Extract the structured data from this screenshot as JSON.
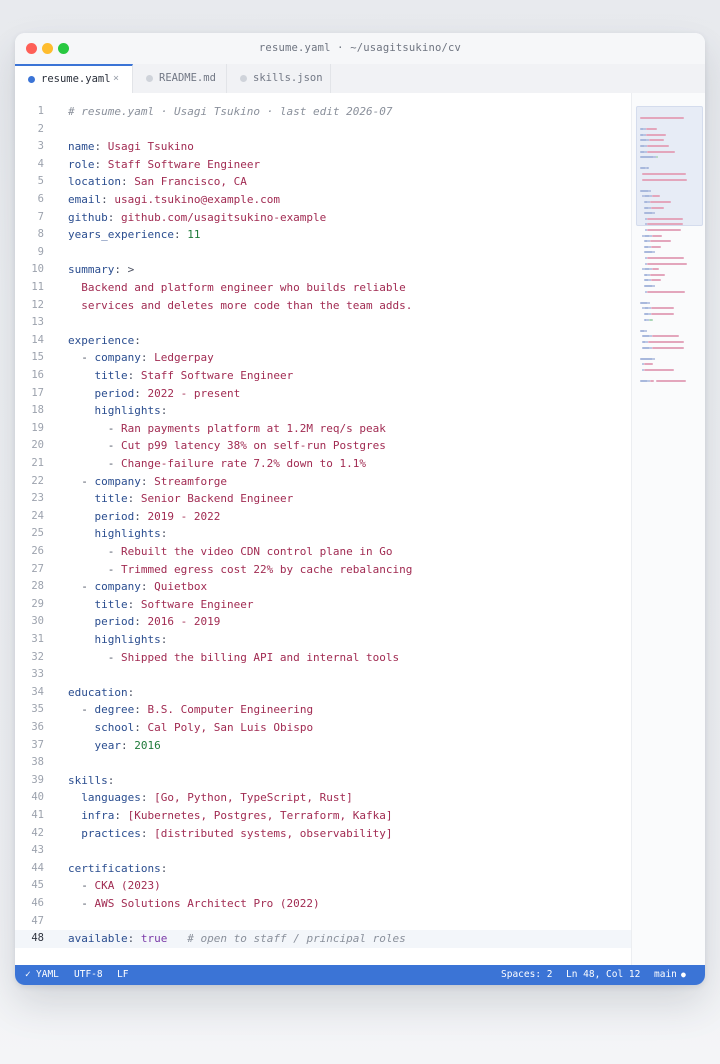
{
  "window": {
    "title": "resume.yaml · ~/usagitsukino/cv"
  },
  "tabs": [
    {
      "label": "resume.yaml",
      "close": "×",
      "active": true
    },
    {
      "label": "README.md",
      "active": false
    },
    {
      "label": "skills.json",
      "active": false
    }
  ],
  "editor": {
    "current_line": 48,
    "lines": [
      [
        [
          "c",
          "# resume.yaml · Usagi Tsukino · last edit 2026-07"
        ]
      ],
      [],
      [
        [
          "k",
          "name"
        ],
        [
          "p",
          ": "
        ],
        [
          "v",
          "Usagi Tsukino"
        ]
      ],
      [
        [
          "k",
          "role"
        ],
        [
          "p",
          ": "
        ],
        [
          "v",
          "Staff Software Engineer"
        ]
      ],
      [
        [
          "k",
          "location"
        ],
        [
          "p",
          ": "
        ],
        [
          "v",
          "San Francisco, CA"
        ]
      ],
      [
        [
          "k",
          "email"
        ],
        [
          "p",
          ": "
        ],
        [
          "v",
          "usagi.tsukino@example.com"
        ]
      ],
      [
        [
          "k",
          "github"
        ],
        [
          "p",
          ": "
        ],
        [
          "v",
          "github.com/usagitsukino-example"
        ]
      ],
      [
        [
          "k",
          "years_experience"
        ],
        [
          "p",
          ": "
        ],
        [
          "n",
          "11"
        ]
      ],
      [],
      [
        [
          "k",
          "summary"
        ],
        [
          "p",
          ": >"
        ]
      ],
      [
        [
          "v",
          "  Backend and platform engineer who builds reliable"
        ]
      ],
      [
        [
          "v",
          "  services and deletes more code than the team adds."
        ]
      ],
      [],
      [
        [
          "k",
          "experience"
        ],
        [
          "p",
          ":"
        ]
      ],
      [
        [
          "p",
          "  - "
        ],
        [
          "k",
          "company"
        ],
        [
          "p",
          ": "
        ],
        [
          "v",
          "Ledgerpay"
        ]
      ],
      [
        [
          "p",
          "    "
        ],
        [
          "k",
          "title"
        ],
        [
          "p",
          ": "
        ],
        [
          "v",
          "Staff Software Engineer"
        ]
      ],
      [
        [
          "p",
          "    "
        ],
        [
          "k",
          "period"
        ],
        [
          "p",
          ": "
        ],
        [
          "v",
          "2022 - present"
        ]
      ],
      [
        [
          "p",
          "    "
        ],
        [
          "k",
          "highlights"
        ],
        [
          "p",
          ":"
        ]
      ],
      [
        [
          "p",
          "      - "
        ],
        [
          "v",
          "Ran payments platform at 1.2M req/s peak"
        ]
      ],
      [
        [
          "p",
          "      - "
        ],
        [
          "v",
          "Cut p99 latency 38% on self-run Postgres"
        ]
      ],
      [
        [
          "p",
          "      - "
        ],
        [
          "v",
          "Change-failure rate 7.2% down to 1.1%"
        ]
      ],
      [
        [
          "p",
          "  - "
        ],
        [
          "k",
          "company"
        ],
        [
          "p",
          ": "
        ],
        [
          "v",
          "Streamforge"
        ]
      ],
      [
        [
          "p",
          "    "
        ],
        [
          "k",
          "title"
        ],
        [
          "p",
          ": "
        ],
        [
          "v",
          "Senior Backend Engineer"
        ]
      ],
      [
        [
          "p",
          "    "
        ],
        [
          "k",
          "period"
        ],
        [
          "p",
          ": "
        ],
        [
          "v",
          "2019 - 2022"
        ]
      ],
      [
        [
          "p",
          "    "
        ],
        [
          "k",
          "highlights"
        ],
        [
          "p",
          ":"
        ]
      ],
      [
        [
          "p",
          "      - "
        ],
        [
          "v",
          "Rebuilt the video CDN control plane in Go"
        ]
      ],
      [
        [
          "p",
          "      - "
        ],
        [
          "v",
          "Trimmed egress cost 22% by cache rebalancing"
        ]
      ],
      [
        [
          "p",
          "  - "
        ],
        [
          "k",
          "company"
        ],
        [
          "p",
          ": "
        ],
        [
          "v",
          "Quietbox"
        ]
      ],
      [
        [
          "p",
          "    "
        ],
        [
          "k",
          "title"
        ],
        [
          "p",
          ": "
        ],
        [
          "v",
          "Software Engineer"
        ]
      ],
      [
        [
          "p",
          "    "
        ],
        [
          "k",
          "period"
        ],
        [
          "p",
          ": "
        ],
        [
          "v",
          "2016 - 2019"
        ]
      ],
      [
        [
          "p",
          "    "
        ],
        [
          "k",
          "highlights"
        ],
        [
          "p",
          ":"
        ]
      ],
      [
        [
          "p",
          "      - "
        ],
        [
          "v",
          "Shipped the billing API and internal tools"
        ]
      ],
      [],
      [
        [
          "k",
          "education"
        ],
        [
          "p",
          ":"
        ]
      ],
      [
        [
          "p",
          "  - "
        ],
        [
          "k",
          "degree"
        ],
        [
          "p",
          ": "
        ],
        [
          "v",
          "B.S. Computer Engineering"
        ]
      ],
      [
        [
          "p",
          "    "
        ],
        [
          "k",
          "school"
        ],
        [
          "p",
          ": "
        ],
        [
          "v",
          "Cal Poly, San Luis Obispo"
        ]
      ],
      [
        [
          "p",
          "    "
        ],
        [
          "k",
          "year"
        ],
        [
          "p",
          ": "
        ],
        [
          "n",
          "2016"
        ]
      ],
      [],
      [
        [
          "k",
          "skills"
        ],
        [
          "p",
          ":"
        ]
      ],
      [
        [
          "p",
          "  "
        ],
        [
          "k",
          "languages"
        ],
        [
          "p",
          ": "
        ],
        [
          "v",
          "[Go, Python, TypeScript, Rust]"
        ]
      ],
      [
        [
          "p",
          "  "
        ],
        [
          "k",
          "infra"
        ],
        [
          "p",
          ": "
        ],
        [
          "v",
          "[Kubernetes, Postgres, Terraform, Kafka]"
        ]
      ],
      [
        [
          "p",
          "  "
        ],
        [
          "k",
          "practices"
        ],
        [
          "p",
          ": "
        ],
        [
          "v",
          "[distributed systems, observability]"
        ]
      ],
      [],
      [
        [
          "k",
          "certifications"
        ],
        [
          "p",
          ":"
        ]
      ],
      [
        [
          "p",
          "  - "
        ],
        [
          "v",
          "CKA (2023)"
        ]
      ],
      [
        [
          "p",
          "  - "
        ],
        [
          "v",
          "AWS Solutions Architect Pro (2022)"
        ]
      ],
      [],
      [
        [
          "k",
          "available"
        ],
        [
          "p",
          ": "
        ],
        [
          "b",
          "true"
        ],
        [
          "p",
          "   "
        ],
        [
          "c",
          "# open to staff / principal roles"
        ]
      ]
    ]
  },
  "statusbar": {
    "check_icon": "✓",
    "language": "YAML",
    "encoding": "UTF-8",
    "eol": "LF",
    "indent": "Spaces: 2",
    "cursor": "Ln 48, Col 12",
    "branch": "main",
    "branch_dot": "●"
  },
  "icons": {
    "window_close": "traffic-light-red",
    "window_minimize": "traffic-light-yellow",
    "window_maximize": "traffic-light-green"
  },
  "colors": {
    "accent": "#3b74d6",
    "key": "#2a4d8f",
    "string": "#a12b52",
    "number": "#1f7a3a",
    "comment": "#8a909b"
  }
}
